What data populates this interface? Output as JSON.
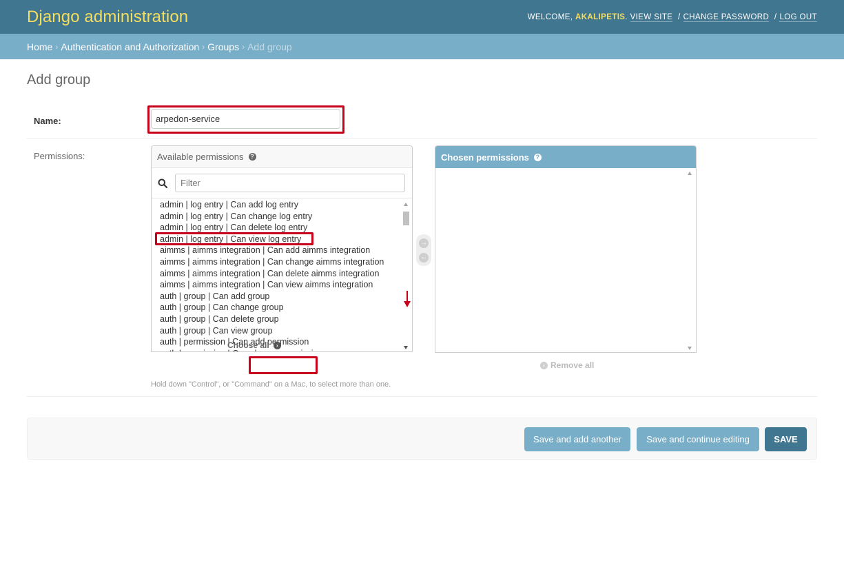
{
  "header": {
    "title": "Django administration",
    "welcome_label": "WELCOME,",
    "username": "AKALIPETIS",
    "username_suffix": ".",
    "view_site": "VIEW SITE",
    "change_password": "CHANGE PASSWORD",
    "log_out": "LOG OUT",
    "separator": "/"
  },
  "breadcrumbs": {
    "home": "Home",
    "app": "Authentication and Authorization",
    "model": "Groups",
    "current": "Add group",
    "separator": "›"
  },
  "page": {
    "title": "Add group"
  },
  "form": {
    "name_label": "Name:",
    "name_value": "arpedon-service",
    "permissions_label": "Permissions:"
  },
  "available": {
    "title": "Available permissions",
    "help_glyph": "?",
    "filter_placeholder": "Filter",
    "items": [
      "admin | log entry | Can add log entry",
      "admin | log entry | Can change log entry",
      "admin | log entry | Can delete log entry",
      "admin | log entry | Can view log entry",
      "aimms | aimms integration | Can add aimms integration",
      "aimms | aimms integration | Can change aimms integration",
      "aimms | aimms integration | Can delete aimms integration",
      "aimms | aimms integration | Can view aimms integration",
      "auth | group | Can add group",
      "auth | group | Can change group",
      "auth | group | Can delete group",
      "auth | group | Can view group",
      "auth | permission | Can add permission",
      "auth | permission | Can change permission"
    ],
    "choose_all": "Choose all"
  },
  "chosen": {
    "title": "Chosen permissions",
    "help_glyph": "?",
    "remove_all": "Remove all"
  },
  "help_text": "Hold down \"Control\", or \"Command\" on a Mac, to select more than one.",
  "buttons": {
    "save_add_another": "Save and add another",
    "save_continue": "Save and continue editing",
    "save": "SAVE"
  },
  "colors": {
    "header_bg": "#417690",
    "brand": "#f5dd5d",
    "breadcrumb_bg": "#79aec8",
    "highlight": "#c8001a"
  }
}
